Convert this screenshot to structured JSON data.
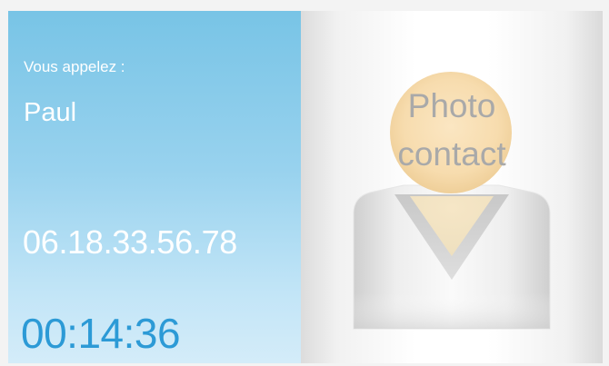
{
  "call": {
    "label": "Vous appelez :",
    "contact_name": "Paul",
    "phone_number": "06.18.33.56.78",
    "duration": "00:14:36"
  },
  "photo": {
    "placeholder_line1": "Photo",
    "placeholder_line2": "contact",
    "placeholder_icon": "person-silhouette-icon"
  },
  "colors": {
    "panel_gradient_top": "#78c4e6",
    "panel_gradient_bottom": "#d4ecf9",
    "timer_text": "#2c9ad6",
    "head_circle": "#f7dcae",
    "placeholder_text": "#a9a9a9"
  }
}
